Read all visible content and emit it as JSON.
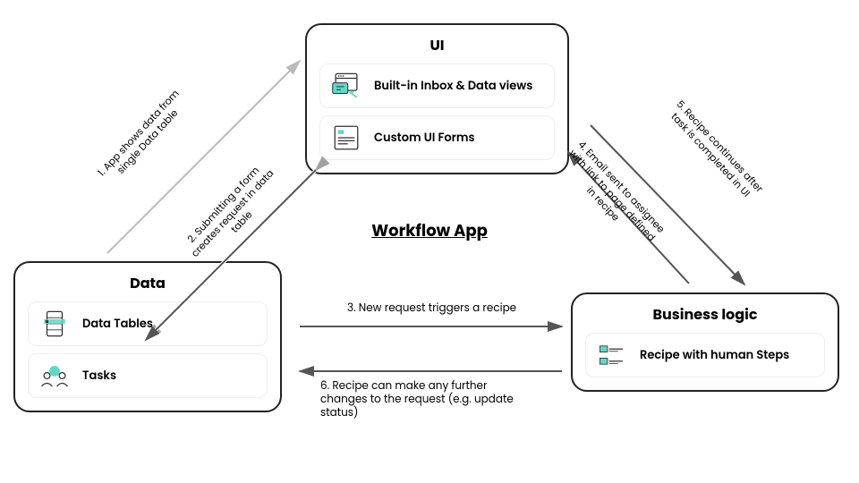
{
  "title": "Workflow App",
  "nodes": {
    "ui": {
      "title": "UI",
      "items": [
        {
          "icon": "inbox-window-icon",
          "label": "Built-in Inbox & Data views"
        },
        {
          "icon": "form-lines-icon",
          "label": "Custom UI Forms"
        }
      ]
    },
    "data": {
      "title": "Data",
      "items": [
        {
          "icon": "data-table-icon",
          "label": "Data Tables"
        },
        {
          "icon": "tasks-people-icon",
          "label": "Tasks"
        }
      ]
    },
    "logic": {
      "title": "Business logic",
      "items": [
        {
          "icon": "recipe-steps-icon",
          "label": "Recipe with human Steps"
        }
      ]
    }
  },
  "edges": {
    "e1": "1. App shows data from single Data table",
    "e2": "2. Submitting a form creates request in data table",
    "e3": "3. New request triggers a recipe",
    "e4": "4. Email sent to assignee with link to page defined in recipe",
    "e5": "5. Recipe continues after task is completed in UI",
    "e6": "6. Recipe can make any further changes to the request (e.g. update status)"
  }
}
